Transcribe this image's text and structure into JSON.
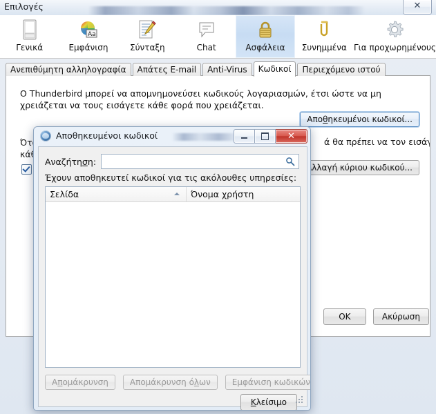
{
  "main_window": {
    "title": "Επιλογές",
    "close_glyph": "✕",
    "close_name": "close-icon"
  },
  "categories": [
    {
      "label": "Γενικά",
      "icon": "general-icon",
      "selected": false
    },
    {
      "label": "Εμφάνιση",
      "icon": "display-icon",
      "selected": false
    },
    {
      "label": "Σύνταξη",
      "icon": "composition-icon",
      "selected": false
    },
    {
      "label": "Chat",
      "icon": "chat-icon",
      "selected": false
    },
    {
      "label": "Ασφάλεια",
      "icon": "security-lock-icon",
      "selected": true
    },
    {
      "label": "Συνημμένα",
      "icon": "attachments-paperclip-icon",
      "selected": false
    },
    {
      "label": "Για προχωρημένους",
      "icon": "advanced-gear-icon",
      "selected": false
    }
  ],
  "tabs": [
    {
      "label": "Ανεπιθύμητη αλληλογραφία",
      "active": false
    },
    {
      "label": "Απάτες E-mail",
      "active": false
    },
    {
      "label": "Anti-Virus",
      "active": false
    },
    {
      "label": "Κωδικοί",
      "active": true
    },
    {
      "label": "Περιεχόμενο ιστού",
      "active": false
    }
  ],
  "panel": {
    "description": "Ο Thunderbird μπορεί να απομνημονεύσει κωδικούς λογαριασμών, έτσι ώστε να μη χρειάζεται να τους εισάγετε κάθε φορά που χρειάζεται.",
    "saved_passwords_button": "Αποθηκευμένοι κωδικοί...",
    "saved_passwords_button_pre": "Απο",
    "saved_passwords_button_accel": "θ",
    "saved_passwords_button_post": "ηκευμένοι κωδικοί...",
    "master_text_visible_left": "Ότα",
    "master_text_visible_left2": "κάθ",
    "master_text_visible_right": "ά θα πρέπει να τον εισάγετε σε",
    "master_button": "Αλλαγή κύριου κωδικού..."
  },
  "main_actions": {
    "ok": "OK",
    "cancel": "Ακύρωση"
  },
  "dialog": {
    "title": "Αποθηκευμένοι κωδικοί",
    "app_icon": "thunderbird-icon",
    "minimize": "minimize-icon",
    "maximize": "maximize-icon",
    "close": "close-icon",
    "search_label": "Αναζήτηση:",
    "search_label_pre": "Αναζήτη",
    "search_label_accel": "σ",
    "search_label_post": "η:",
    "search_value": "",
    "search_placeholder": "",
    "search_icon": "search-icon",
    "hint": "Έχουν αποθηκευτεί κωδικοί για τις ακόλουθες υπηρεσίες:",
    "columns": [
      {
        "label": "Σελίδα",
        "sorted": "asc"
      },
      {
        "label": "Όνομα χρήστη",
        "sorted": ""
      }
    ],
    "rows": [],
    "buttons": {
      "remove_pre": "Α",
      "remove_accel": "π",
      "remove_post": "ομάκρυνση",
      "remove": "Απομάκρυνση",
      "remove_all_pre": "Απομάκρυνση ό",
      "remove_all_accel": "λ",
      "remove_all_post": "ων",
      "remove_all": "Απομάκρυνση όλων",
      "show_passwords": "Εμφάνιση κωδικών",
      "close_pre": "",
      "close_accel": "Κ",
      "close_post": "λείσιμο",
      "close": "Κλείσιμο"
    }
  },
  "colors": {
    "accent": "#c7dcf3",
    "dialog_close_red": "#c0342a",
    "lock_gold": "#c9a227",
    "search_icon_blue": "#3e6f9e"
  }
}
